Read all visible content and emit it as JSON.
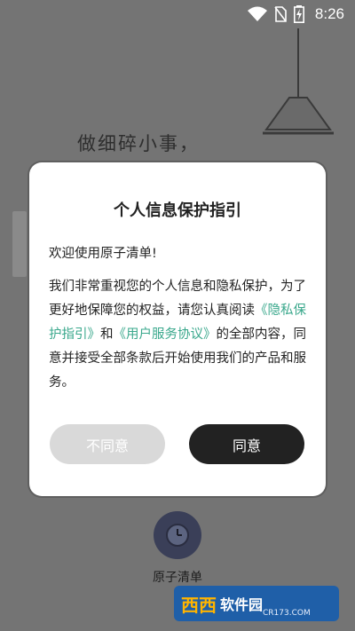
{
  "status_bar": {
    "time": "8:26",
    "icons": [
      "wifi-icon",
      "no-sim-icon",
      "battery-charging-icon"
    ]
  },
  "background": {
    "headline": "做细碎小事，",
    "app_name": "原子清单",
    "app_icon": "clock-icon"
  },
  "dialog": {
    "title": "个人信息保护指引",
    "greeting": "欢迎使用原子清单!",
    "body_part1": "我们非常重视您的个人信息和隐私保护，为了更好地保障您的权益，请您认真阅读",
    "privacy_link": "《隐私保护指引》",
    "body_and": "和",
    "terms_link": "《用户服务协议》",
    "body_part2": "的全部内容，同意并接受全部条款后开始使用我们的产品和服务。",
    "disagree_label": "不同意",
    "agree_label": "同意"
  },
  "watermark": {
    "logo": "西西",
    "name": "软件园",
    "url": "CR173.COM"
  },
  "colors": {
    "link": "#3aa88c",
    "agree_bg": "#222222",
    "disagree_bg": "#d9d9d9"
  }
}
